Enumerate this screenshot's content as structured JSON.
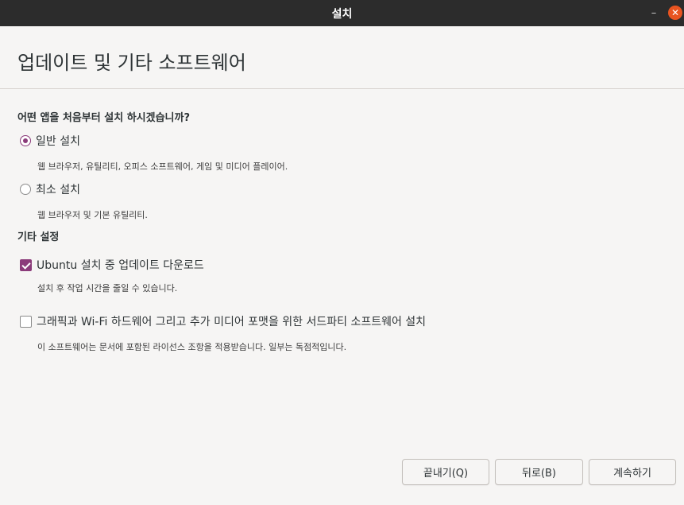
{
  "window": {
    "title": "설치",
    "minimize_symbol": "–",
    "close_symbol": "✕"
  },
  "header": {
    "title": "업데이트 및 기타 소프트웨어"
  },
  "install_type": {
    "question": "어떤 앱을 처음부터 설치 하시겠습니까?",
    "options": [
      {
        "label": "일반 설치",
        "description": "웹 브라우저, 유틸리티, 오피스  소프트웨어, 게임 및 미디어 플레이어.",
        "selected": true
      },
      {
        "label": "최소 설치",
        "description": "웹 브라우저 및 기본 유틸리티.",
        "selected": false
      }
    ]
  },
  "other_settings": {
    "title": "기타 설정",
    "options": [
      {
        "label": "Ubuntu 설치 중 업데이트 다운로드",
        "description": "설치 후 작업 시간을 줄일 수 있습니다.",
        "checked": true
      },
      {
        "label": "그래픽과 Wi-Fi 하드웨어 그리고 추가 미디어 포맷을 위한 서드파티 소프트웨어 설치",
        "description": "이 소프트웨어는 문서에 포함된 라이선스 조항을 적용받습니다. 일부는 독점적입니다.",
        "checked": false
      }
    ]
  },
  "buttons": {
    "quit": "끝내기(Q)",
    "back": "뒤로(B)",
    "continue": "계속하기"
  },
  "colors": {
    "accent": "#8b3b7a",
    "close": "#e95420",
    "titlebar": "#2c2c2c"
  }
}
